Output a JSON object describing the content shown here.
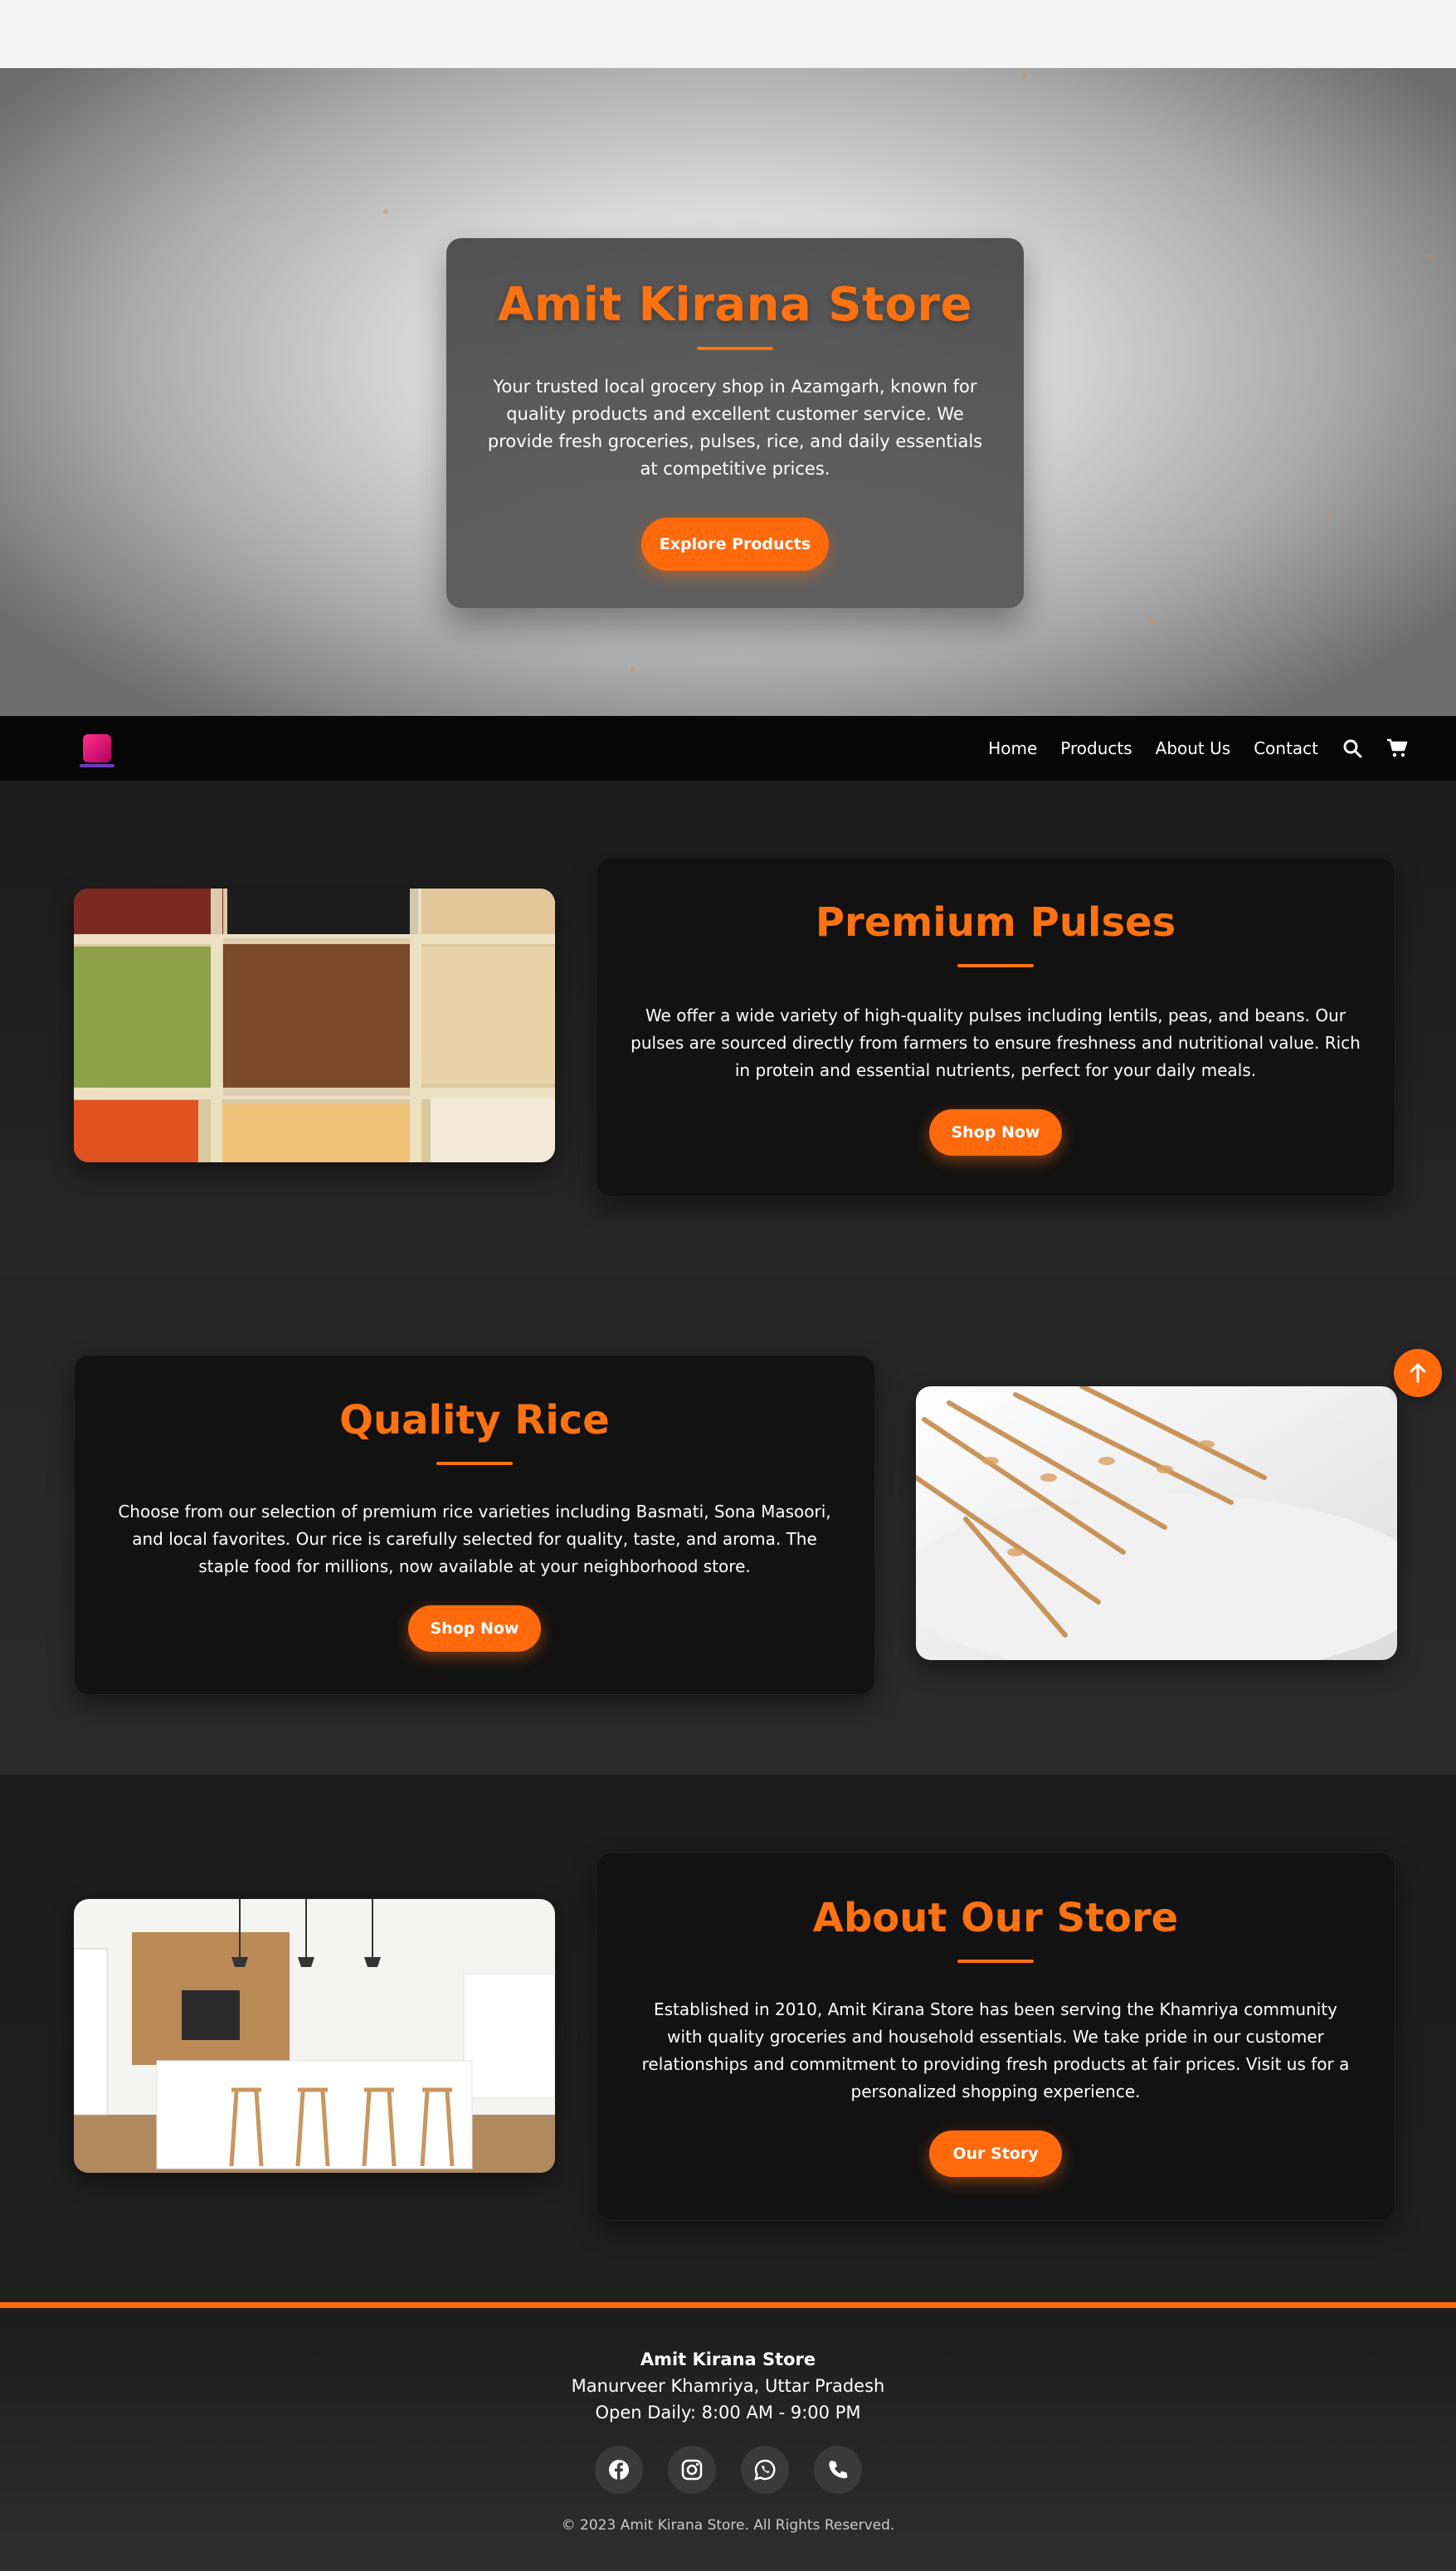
{
  "hero": {
    "title": "Amit Kirana Store",
    "description": "Your trusted local grocery shop in Azamgarh, known for quality products and excellent customer service. We provide fresh groceries, pulses, rice, and daily essentials at competitive prices.",
    "button": "Explore Products"
  },
  "nav": {
    "links": [
      "Home",
      "Products",
      "About Us",
      "Contact"
    ],
    "icons": [
      "search-icon",
      "cart-icon"
    ]
  },
  "sections": [
    {
      "title": "Premium Pulses",
      "text": "We offer a wide variety of high-quality pulses including lentils, peas, and beans. Our pulses are sourced directly from farmers to ensure freshness and nutritional value. Rich in protein and essential nutrients, perfect for your daily meals.",
      "button": "Shop Now"
    },
    {
      "title": "Quality Rice",
      "text": "Choose from our selection of premium rice varieties including Basmati, Sona Masoori, and local favorites. Our rice is carefully selected for quality, taste, and aroma. The staple food for millions, now available at your neighborhood store.",
      "button": "Shop Now"
    },
    {
      "title": "About Our Store",
      "text": "Established in 2010, Amit Kirana Store has been serving the Khamriya community with quality groceries and household essentials. We take pride in our customer relationships and commitment to providing fresh products at fair prices. Visit us for a personalized shopping experience.",
      "button": "Our Story"
    }
  ],
  "footer": {
    "name": "Amit Kirana Store",
    "address": "Manurveer Khamriya, Uttar Pradesh",
    "hours": "Open Daily: 8:00 AM - 9:00 PM",
    "social_icons": [
      "facebook-icon",
      "instagram-icon",
      "whatsapp-icon",
      "phone-icon"
    ],
    "copyright": "© 2023 Amit Kirana Store. All Rights Reserved."
  },
  "colors": {
    "accent": "#ff6a0d",
    "card_bg": "#121212",
    "nav_bg": "#060606"
  }
}
